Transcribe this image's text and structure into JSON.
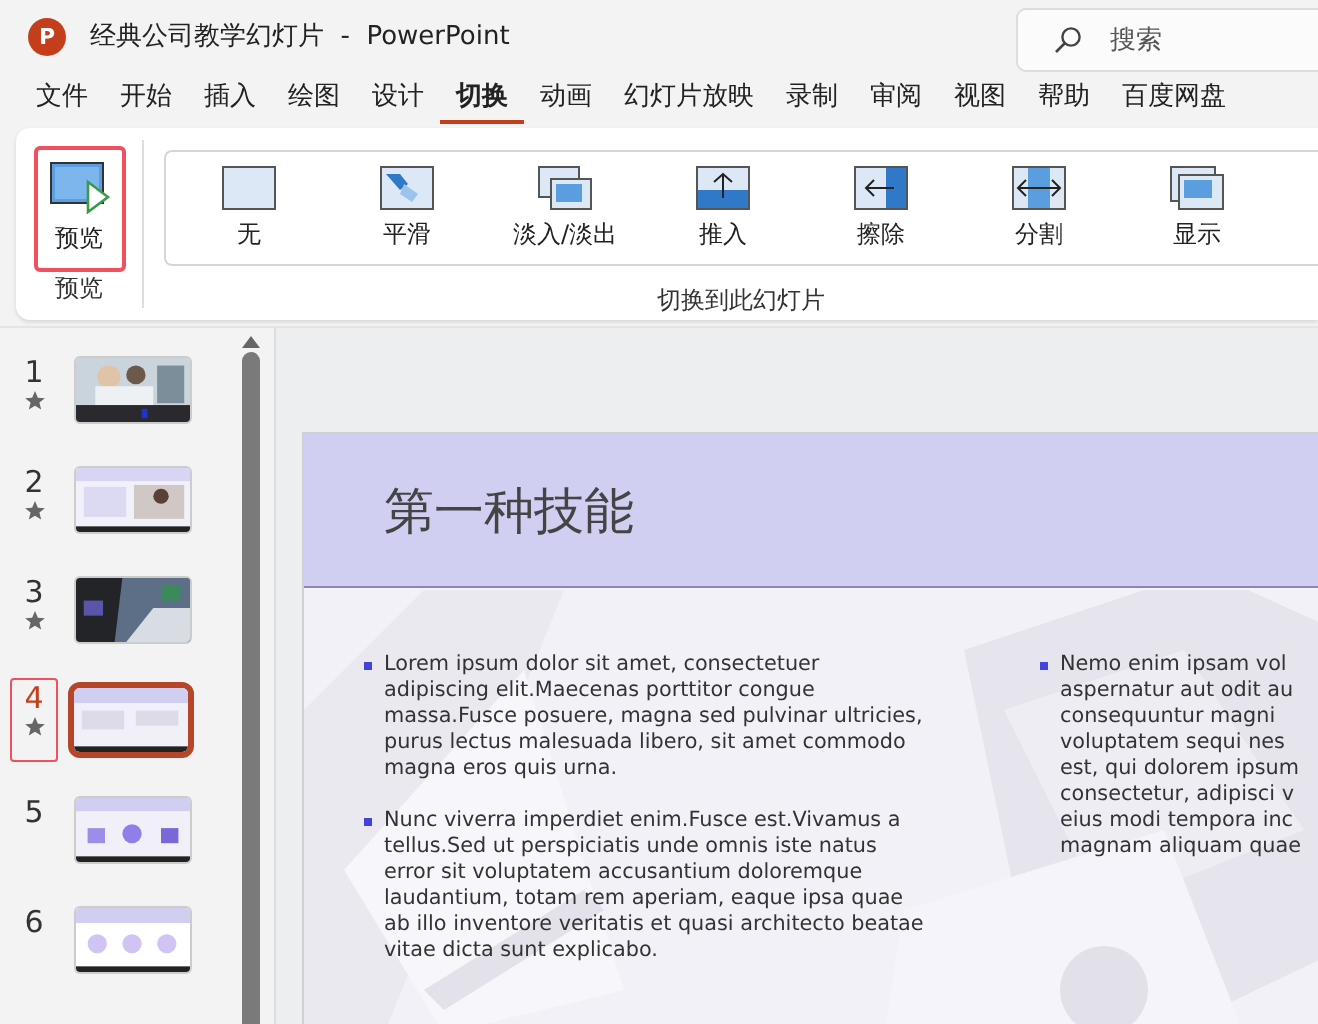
{
  "window": {
    "app_icon_letter": "P",
    "title": "经典公司教学幻灯片  -  PowerPoint"
  },
  "search": {
    "placeholder": "搜索"
  },
  "tabs": [
    {
      "label": "文件",
      "selected": false
    },
    {
      "label": "开始",
      "selected": false
    },
    {
      "label": "插入",
      "selected": false
    },
    {
      "label": "绘图",
      "selected": false
    },
    {
      "label": "设计",
      "selected": false
    },
    {
      "label": "切换",
      "selected": true
    },
    {
      "label": "动画",
      "selected": false
    },
    {
      "label": "幻灯片放映",
      "selected": false
    },
    {
      "label": "录制",
      "selected": false
    },
    {
      "label": "审阅",
      "selected": false
    },
    {
      "label": "视图",
      "selected": false
    },
    {
      "label": "帮助",
      "selected": false
    },
    {
      "label": "百度网盘",
      "selected": false
    }
  ],
  "ribbon": {
    "preview_group": {
      "button": "预览",
      "highlighted": true,
      "group_label": "预览"
    },
    "transitions_group": {
      "group_label": "切换到此幻灯片",
      "items": [
        {
          "kind": "none",
          "label": "无"
        },
        {
          "kind": "morph",
          "label": "平滑"
        },
        {
          "kind": "fade",
          "label": "淡入/淡出"
        },
        {
          "kind": "push",
          "label": "推入"
        },
        {
          "kind": "wipe",
          "label": "擦除"
        },
        {
          "kind": "split",
          "label": "分割"
        },
        {
          "kind": "reveal",
          "label": "显示"
        }
      ]
    }
  },
  "slides": [
    {
      "number": "1",
      "has_transition": true,
      "selected": false,
      "highlighted": false
    },
    {
      "number": "2",
      "has_transition": true,
      "selected": false,
      "highlighted": false,
      "kind": "text-photo"
    },
    {
      "number": "3",
      "has_transition": true,
      "selected": false,
      "highlighted": false,
      "kind": "dark-photo"
    },
    {
      "number": "4",
      "has_transition": true,
      "selected": true,
      "highlighted": true,
      "kind": "two-columns"
    },
    {
      "number": "5",
      "has_transition": false,
      "selected": false,
      "highlighted": false,
      "kind": "three-icons"
    },
    {
      "number": "6",
      "has_transition": false,
      "selected": false,
      "highlighted": false,
      "kind": "three-circles"
    }
  ],
  "current_slide": {
    "title": "第一种技能",
    "columns": [
      {
        "paragraphs": [
          {
            "lines": [
              "Lorem ipsum dolor sit amet, consectetuer",
              "adipiscing elit.Maecenas porttitor congue",
              "massa.Fusce posuere, magna sed pulvinar ultricies,",
              "purus lectus malesuada libero, sit amet commodo",
              "magna eros quis urna."
            ]
          },
          {
            "lines": [
              "Nunc viverra imperdiet enim.Fusce est.Vivamus a",
              "tellus.Sed ut perspiciatis unde omnis iste natus",
              "error sit voluptatem accusantium doloremque",
              "laudantium, totam rem aperiam, eaque ipsa quae",
              "ab illo inventore veritatis et quasi architecto beatae",
              "vitae dicta sunt explicabo."
            ]
          }
        ]
      },
      {
        "paragraphs": [
          {
            "lines": [
              "Nemo enim ipsam vol",
              "aspernatur aut odit au",
              "consequuntur magni",
              "voluptatem sequi nes",
              "est, qui dolorem ipsum",
              "consectetur, adipisci v",
              "eius modi tempora inc",
              "magnam aliquam quae"
            ]
          }
        ]
      }
    ]
  }
}
